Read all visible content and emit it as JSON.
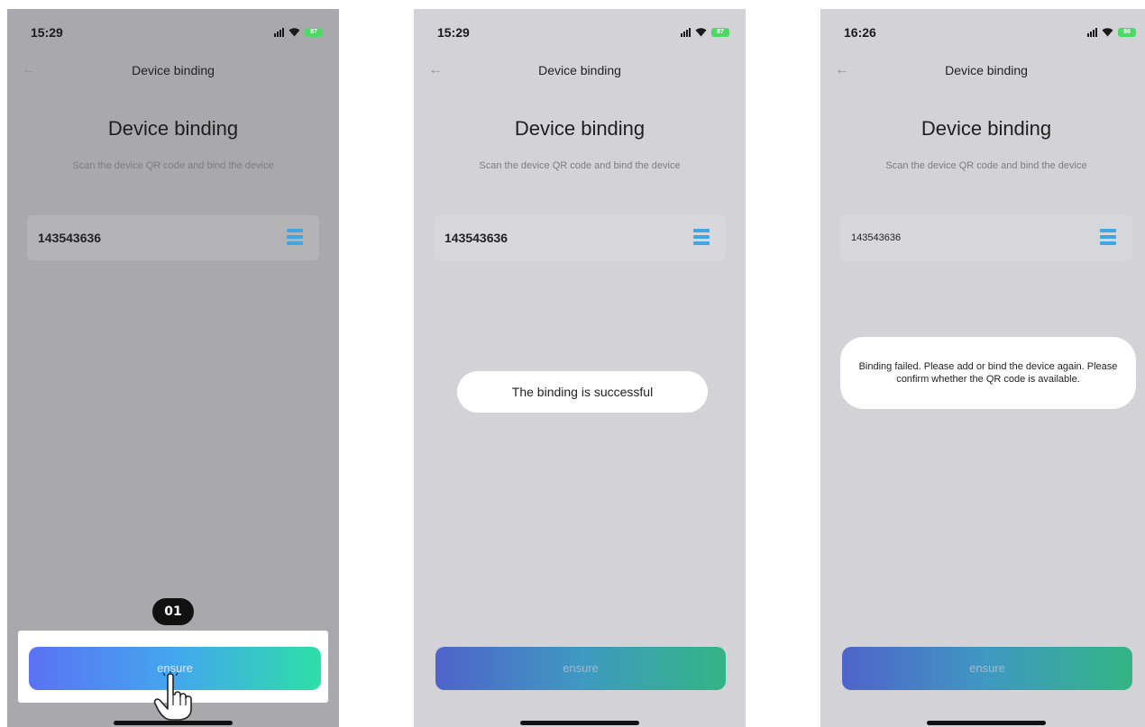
{
  "screens": [
    {
      "time": "15:29",
      "battery": "87",
      "nav_title": "Device binding",
      "heading": "Device binding",
      "subtitle": "Scan the device QR code and bind the device",
      "field_value": "143543636",
      "button_label": "ensure",
      "step_badge": "01"
    },
    {
      "time": "15:29",
      "battery": "87",
      "nav_title": "Device binding",
      "heading": "Device binding",
      "subtitle": "Scan the device QR code and bind the device",
      "field_value": "143543636",
      "toast": "The binding is successful",
      "button_label": "ensure"
    },
    {
      "time": "16:26",
      "battery": "86",
      "nav_title": "Device binding",
      "heading": "Device binding",
      "subtitle": "Scan the device QR code and bind the device",
      "field_value": "143543636",
      "toast": "Binding failed. Please add or bind the device again. Please confirm whether the QR code is available.",
      "button_label": "ensure"
    }
  ],
  "icons": {
    "back": "back-arrow-icon",
    "signal": "signal-icon",
    "wifi": "wifi-icon",
    "battery": "battery-icon",
    "scan": "scan-icon",
    "tap": "tap-hand-icon"
  },
  "colors": {
    "button_gradient": [
      "#5b72f3",
      "#43a7ee",
      "#2ddfa7"
    ],
    "scan_icon": "#41a6df",
    "battery": "#4cd964"
  }
}
